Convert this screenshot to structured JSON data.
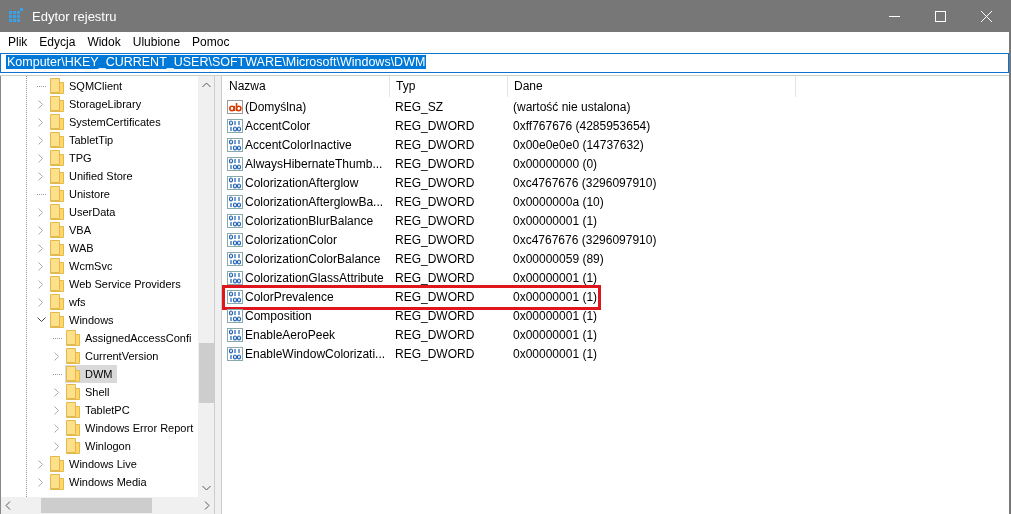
{
  "window": {
    "title": "Edytor rejestru"
  },
  "menu": [
    "Plik",
    "Edycja",
    "Widok",
    "Ulubione",
    "Pomoc"
  ],
  "address": {
    "value": "Komputer\\HKEY_CURRENT_USER\\SOFTWARE\\Microsoft\\Windows\\DWM",
    "selected": true
  },
  "tree": [
    {
      "label": "SQMClient",
      "kind": "leaf",
      "selected": false
    },
    {
      "label": "StorageLibrary",
      "kind": "collapsed",
      "selected": false
    },
    {
      "label": "SystemCertificates",
      "kind": "collapsed",
      "selected": false
    },
    {
      "label": "TabletTip",
      "kind": "collapsed",
      "selected": false
    },
    {
      "label": "TPG",
      "kind": "collapsed",
      "selected": false
    },
    {
      "label": "Unified Store",
      "kind": "collapsed",
      "selected": false
    },
    {
      "label": "Unistore",
      "kind": "leaf",
      "selected": false
    },
    {
      "label": "UserData",
      "kind": "collapsed",
      "selected": false
    },
    {
      "label": "VBA",
      "kind": "collapsed",
      "selected": false
    },
    {
      "label": "WAB",
      "kind": "collapsed",
      "selected": false
    },
    {
      "label": "WcmSvc",
      "kind": "collapsed",
      "selected": false
    },
    {
      "label": "Web Service Providers",
      "kind": "collapsed",
      "selected": false
    },
    {
      "label": "wfs",
      "kind": "collapsed",
      "selected": false
    },
    {
      "label": "Windows",
      "kind": "expanded",
      "selected": false,
      "children": [
        {
          "label": "AssignedAccessConfi",
          "kind": "leaf",
          "selected": false
        },
        {
          "label": "CurrentVersion",
          "kind": "collapsed",
          "selected": false
        },
        {
          "label": "DWM",
          "kind": "leaf",
          "selected": true
        },
        {
          "label": "Shell",
          "kind": "collapsed",
          "selected": false
        },
        {
          "label": "TabletPC",
          "kind": "collapsed",
          "selected": false
        },
        {
          "label": "Windows Error Report",
          "kind": "collapsed",
          "selected": false
        },
        {
          "label": "Winlogon",
          "kind": "collapsed",
          "selected": false
        }
      ]
    },
    {
      "label": "Windows Live",
      "kind": "collapsed",
      "selected": false
    },
    {
      "label": "Windows Media",
      "kind": "collapsed",
      "selected": false
    }
  ],
  "table": {
    "columns": [
      "Nazwa",
      "Typ",
      "Dane"
    ],
    "rows": [
      {
        "kind": "string",
        "name": "(Domyślna)",
        "type": "REG_SZ",
        "data": "(wartość nie ustalona)",
        "highlighted": false
      },
      {
        "kind": "binary",
        "name": "AccentColor",
        "type": "REG_DWORD",
        "data": "0xff767676 (4285953654)",
        "highlighted": false
      },
      {
        "kind": "binary",
        "name": "AccentColorInactive",
        "type": "REG_DWORD",
        "data": "0x00e0e0e0 (14737632)",
        "highlighted": false
      },
      {
        "kind": "binary",
        "name": "AlwaysHibernateThumb...",
        "type": "REG_DWORD",
        "data": "0x00000000 (0)",
        "highlighted": false
      },
      {
        "kind": "binary",
        "name": "ColorizationAfterglow",
        "type": "REG_DWORD",
        "data": "0xc4767676 (3296097910)",
        "highlighted": false
      },
      {
        "kind": "binary",
        "name": "ColorizationAfterglowBa...",
        "type": "REG_DWORD",
        "data": "0x0000000a (10)",
        "highlighted": false
      },
      {
        "kind": "binary",
        "name": "ColorizationBlurBalance",
        "type": "REG_DWORD",
        "data": "0x00000001 (1)",
        "highlighted": false
      },
      {
        "kind": "binary",
        "name": "ColorizationColor",
        "type": "REG_DWORD",
        "data": "0xc4767676 (3296097910)",
        "highlighted": false
      },
      {
        "kind": "binary",
        "name": "ColorizationColorBalance",
        "type": "REG_DWORD",
        "data": "0x00000059 (89)",
        "highlighted": false
      },
      {
        "kind": "binary",
        "name": "ColorizationGlassAttribute",
        "type": "REG_DWORD",
        "data": "0x00000001 (1)",
        "highlighted": false
      },
      {
        "kind": "binary",
        "name": "ColorPrevalence",
        "type": "REG_DWORD",
        "data": "0x00000001 (1)",
        "highlighted": true
      },
      {
        "kind": "binary",
        "name": "Composition",
        "type": "REG_DWORD",
        "data": "0x00000001 (1)",
        "highlighted": false
      },
      {
        "kind": "binary",
        "name": "EnableAeroPeek",
        "type": "REG_DWORD",
        "data": "0x00000001 (1)",
        "highlighted": false
      },
      {
        "kind": "binary",
        "name": "EnableWindowColorizati...",
        "type": "REG_DWORD",
        "data": "0x00000001 (1)",
        "highlighted": false
      }
    ]
  }
}
